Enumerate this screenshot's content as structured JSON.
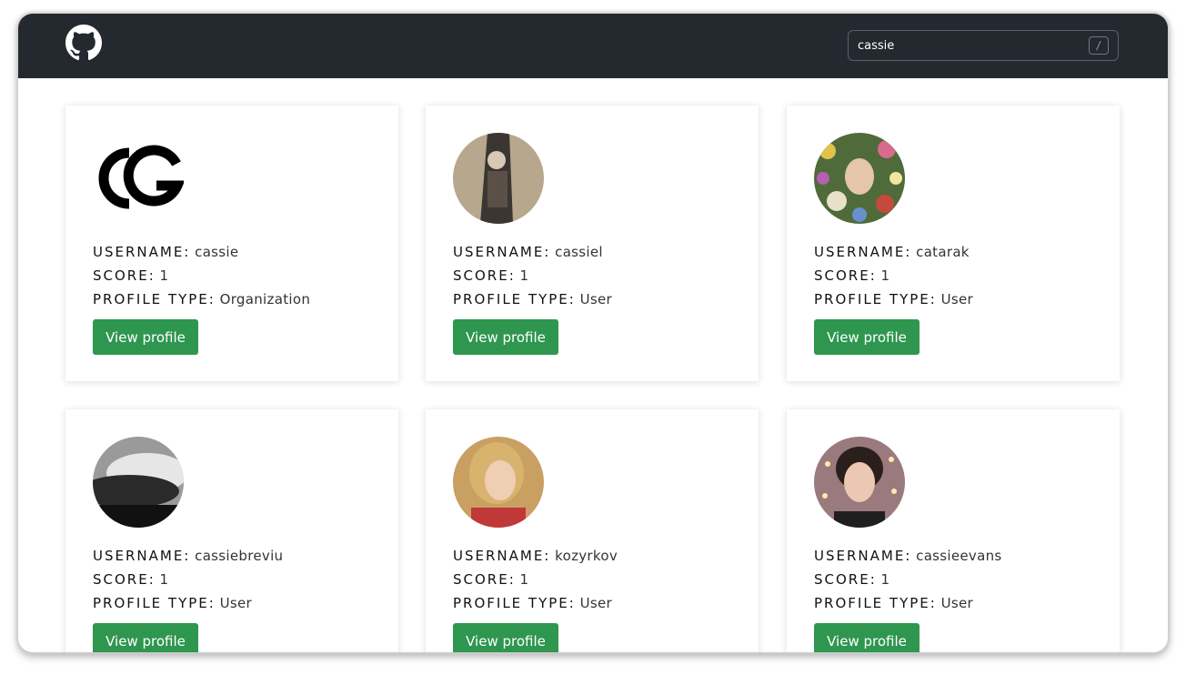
{
  "search": {
    "value": "cassie",
    "shortcut": "/"
  },
  "view_label": "View profile",
  "labels": {
    "username": "USERNAME:",
    "score": "SCORE:",
    "type": "PROFILE TYPE:"
  },
  "cards": [
    {
      "username": "cassie",
      "score": "1",
      "type": "Organization",
      "avatar": "cg-logo"
    },
    {
      "username": "cassiel",
      "score": "1",
      "type": "User",
      "avatar": "photo"
    },
    {
      "username": "catarak",
      "score": "1",
      "type": "User",
      "avatar": "photo"
    },
    {
      "username": "cassiebreviu",
      "score": "1",
      "type": "User",
      "avatar": "photo"
    },
    {
      "username": "kozyrkov",
      "score": "1",
      "type": "User",
      "avatar": "photo"
    },
    {
      "username": "cassieevans",
      "score": "1",
      "type": "User",
      "avatar": "photo"
    }
  ],
  "colors": {
    "topbar": "#24292f",
    "button": "#2f9650"
  }
}
